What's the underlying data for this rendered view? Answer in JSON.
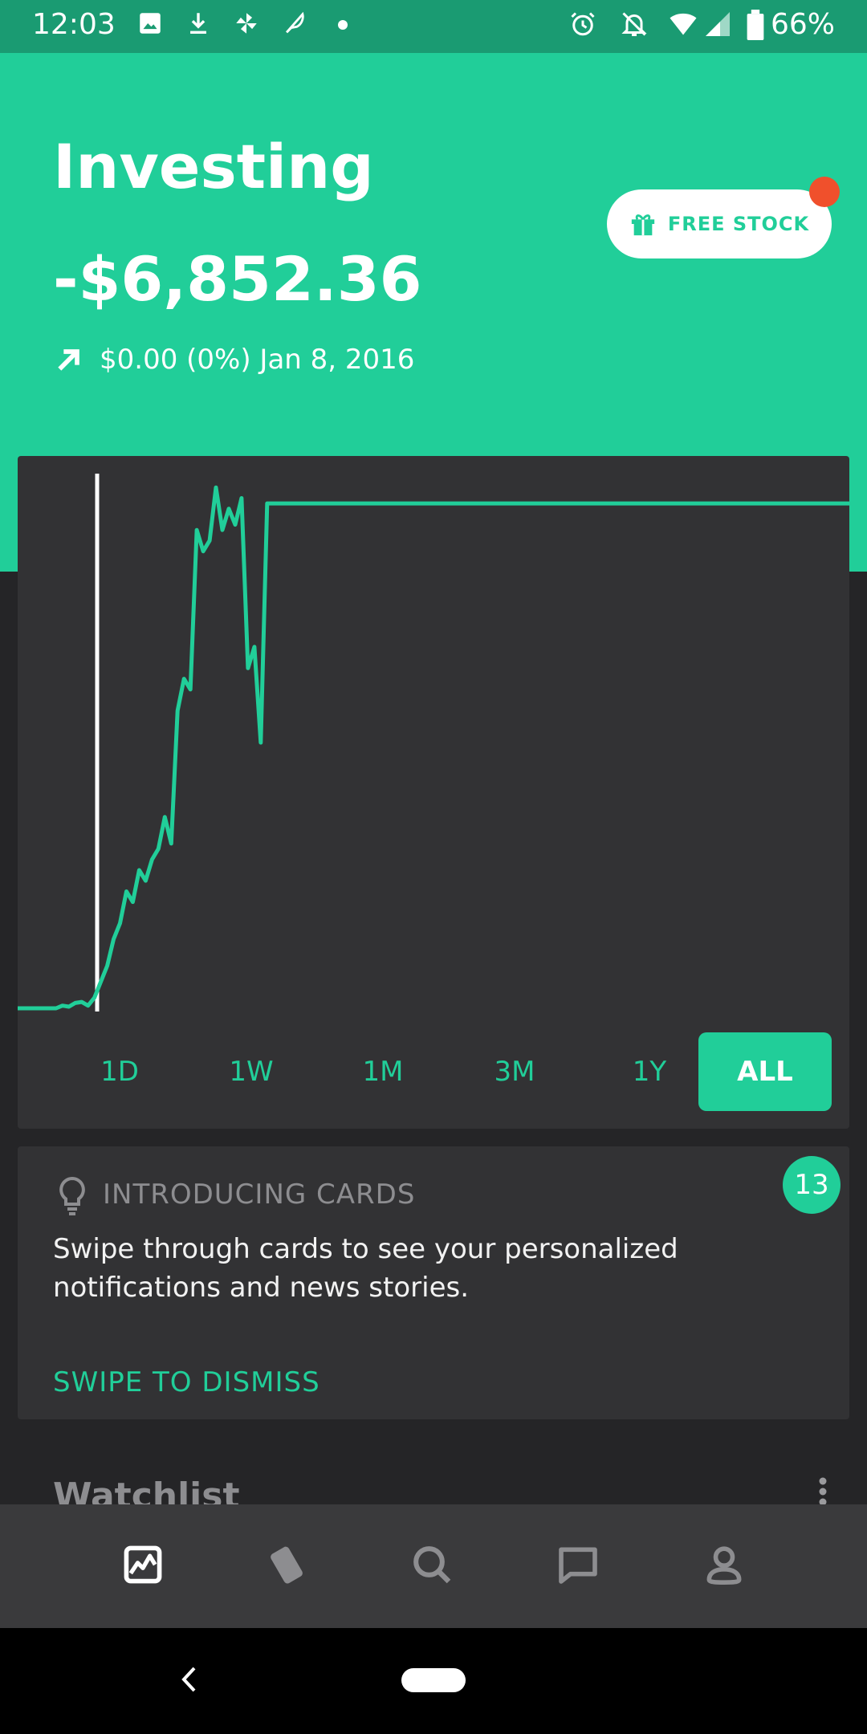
{
  "status_bar": {
    "time": "12:03",
    "battery": "66%"
  },
  "header": {
    "title": "Investing",
    "balance": "-$6,852.36",
    "change_text": "$0.00 (0%) Jan 8, 2016",
    "free_stock_label": "FREE STOCK"
  },
  "colors": {
    "accent": "#21ce99",
    "status": "#1a9b72",
    "card": "#323234",
    "background": "#252527",
    "notification": "#f0502c"
  },
  "chart_data": {
    "type": "line",
    "series": [
      {
        "values": [
          0,
          0,
          0,
          0,
          0,
          0,
          0,
          0.5,
          0.3,
          1,
          1.2,
          0.5,
          2,
          5,
          8,
          13,
          16,
          22,
          20,
          26,
          24,
          28,
          30,
          36,
          31,
          56,
          62,
          60,
          90,
          86,
          88,
          98,
          90,
          94,
          91,
          96,
          64,
          68,
          50,
          95,
          95,
          95,
          95,
          95
        ]
      }
    ]
  },
  "ranges": [
    "1D",
    "1W",
    "1M",
    "3M",
    "1Y",
    "ALL"
  ],
  "intro_card": {
    "title": "INTRODUCING CARDS",
    "body": "Swipe through cards to see your personalized notifications and news stories.",
    "action": "SWIPE TO DISMISS",
    "count": "13"
  },
  "watchlist": {
    "title": "Watchlist"
  },
  "bottom_nav": [
    "portfolio-icon",
    "cards-icon",
    "search-icon",
    "messages-icon",
    "account-icon"
  ]
}
